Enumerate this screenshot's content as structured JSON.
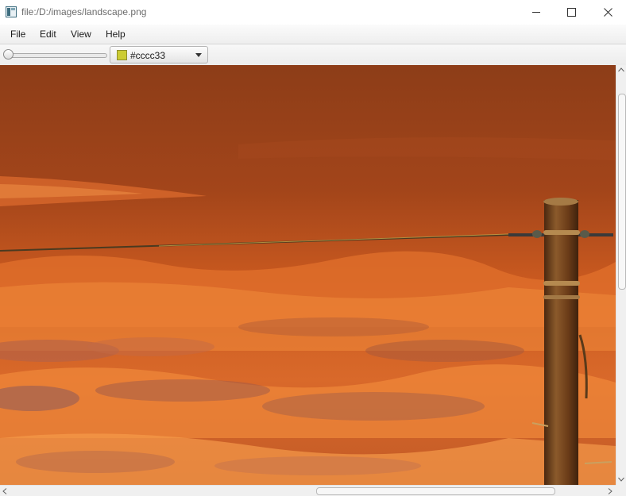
{
  "window": {
    "title": "file:/D:/images/landscape.png",
    "app_icon": "app-window-icon",
    "controls": [
      "minimize-icon",
      "maximize-icon",
      "close-icon"
    ]
  },
  "menu": {
    "items": [
      "File",
      "Edit",
      "View",
      "Help"
    ]
  },
  "toolbar": {
    "zoom_slider_value": 0,
    "color_picker": {
      "value_label": "#cccc33",
      "swatch_color": "#cccc33"
    }
  },
  "image": {
    "description_icon": "landscape-image",
    "colors": {
      "sky_top": "#8f3f17",
      "sky_mid": "#b14b1c",
      "clouds": "#f07a2c",
      "pole": "#6b3b18"
    }
  },
  "scrollbars": {
    "vertical_thumb_fraction_start": 0.07,
    "horizontal_thumb_fraction_start": 0.51
  }
}
